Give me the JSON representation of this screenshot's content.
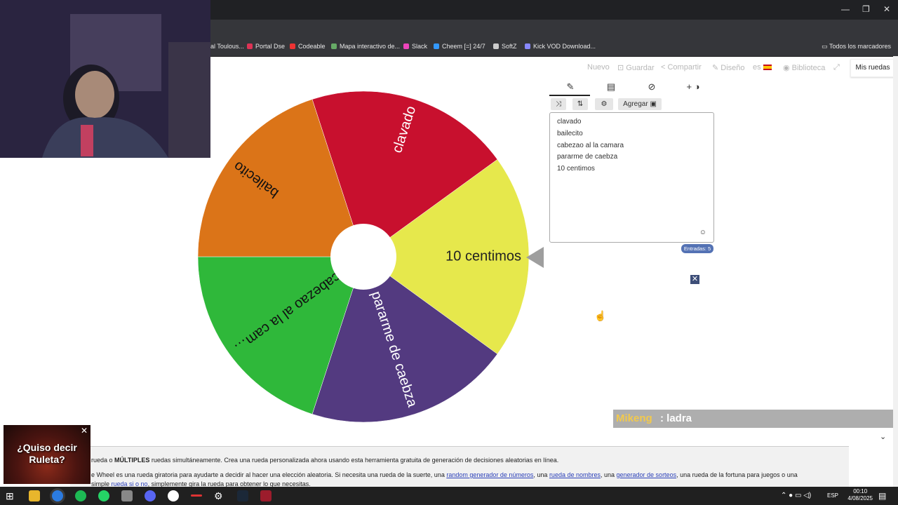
{
  "browser": {
    "bookmarks": [
      {
        "label": "al Toulous...",
        "color": "#7a9ad9"
      },
      {
        "label": "Portal Dse",
        "color": "#d35"
      },
      {
        "label": "Codeable",
        "color": "#e33"
      },
      {
        "label": "Mapa interactivo de...",
        "color": "#6a6"
      },
      {
        "label": "Slack",
        "color": "#e4b"
      },
      {
        "label": "Cheem [=] 24/7",
        "color": "#39f"
      },
      {
        "label": "SoftZ",
        "color": "#ccc"
      },
      {
        "label": "Kick VOD Download...",
        "color": "#88f"
      }
    ],
    "bookmarks_all": "Todos los marcadores"
  },
  "toolbar": {
    "nuevo": "Nuevo",
    "guardar": "Guardar",
    "compartir": "Compartir",
    "diseno": "Diseño",
    "lang": "es",
    "biblioteca": "Biblioteca",
    "mis_ruedas": "Mis ruedas"
  },
  "editor": {
    "agregar": "Agregar",
    "entries": [
      "clavado",
      "bailecito",
      "cabezao al la camara",
      "pararme de caebza",
      "10 centimos"
    ],
    "count_label": "Entradas: 5"
  },
  "wheel": {
    "segments": [
      {
        "label": "10 centimos",
        "color": "#e6e84c",
        "text_color": "#222222"
      },
      {
        "label": "pararme de caebza",
        "color": "#533a80",
        "text_color": "#ffffff"
      },
      {
        "label": "cabezao al la cam…",
        "color": "#2fb83a",
        "text_color": "#111111"
      },
      {
        "label": "bailecito",
        "color": "#db7418",
        "text_color": "#111111"
      },
      {
        "label": "clavado",
        "color": "#c8102e",
        "text_color": "#ffffff"
      }
    ]
  },
  "chat": {
    "user": "Mikeng",
    "message": ": ladra"
  },
  "info": {
    "p1_a": "rueda o ",
    "p1_b": "MÚLTIPLES",
    "p1_c": " ruedas simultáneamente. Crea una rueda personalizada ahora usando esta herramienta gratuita de generación de decisiones aleatorias en línea.",
    "p2_a": "e Wheel es una rueda giratoria para ayudarte a decidir al hacer una elección aleatoria. Si necesita una rueda de la suerte, una ",
    "link1": "random generador de números",
    "p2_b": ", una ",
    "link2": "rueda de nombres",
    "p2_c": ", una ",
    "link3": "generador de sorteos",
    "p2_d": ", una rueda de la fortuna para juegos o una",
    "p3_a": "simple ",
    "link4": "rueda si o no",
    "p3_b": ", simplemente gira la rueda para obtener lo que necesitas."
  },
  "ad": {
    "line": "¿Quiso decir Ruleta?"
  },
  "taskbar": {
    "lang": "ESP",
    "time": "00:10",
    "date": "4/08/2025"
  }
}
